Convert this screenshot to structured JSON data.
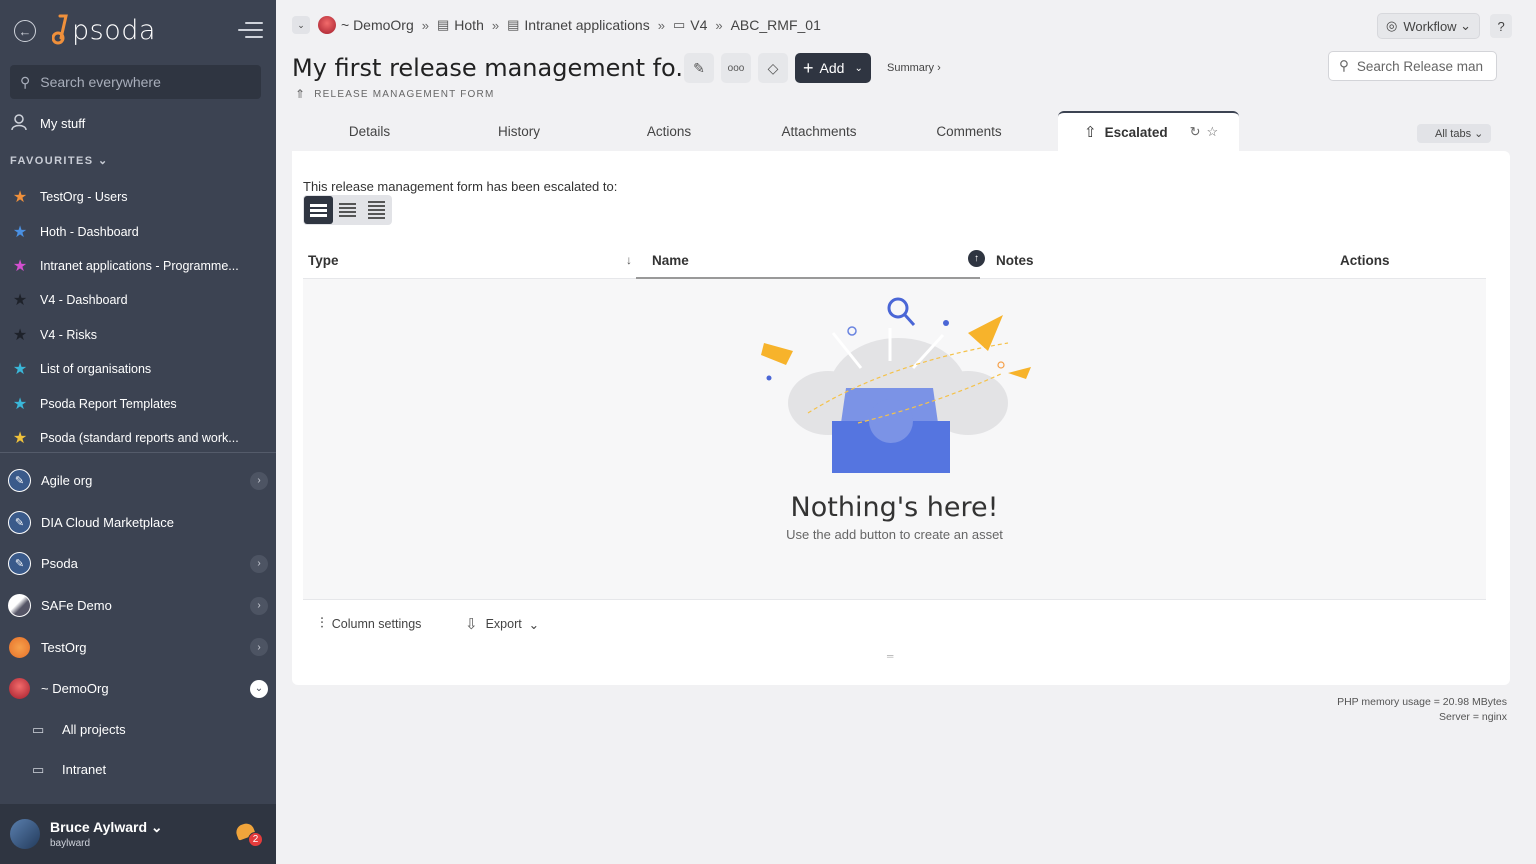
{
  "sidebar": {
    "logo_text": "psoda",
    "search_placeholder": "Search everywhere",
    "my_stuff": "My stuff",
    "favourites_header": "FAVOURITES",
    "favourites": [
      {
        "label": "TestOrg - Users",
        "color": "#f0903b"
      },
      {
        "label": "Hoth - Dashboard",
        "color": "#4a90e2"
      },
      {
        "label": "Intranet applications - Programme...",
        "color": "#d44fd0"
      },
      {
        "label": "V4 - Dashboard",
        "color": "#2a2f38"
      },
      {
        "label": "V4 - Risks",
        "color": "#2a2f38"
      },
      {
        "label": "List of organisations",
        "color": "#3ab7d9"
      },
      {
        "label": "Psoda Report Templates",
        "color": "#3ab7d9"
      },
      {
        "label": "Psoda (standard reports and work...",
        "color": "#f0c23b"
      }
    ],
    "orgs": [
      {
        "label": "Agile org",
        "has_chevron": true
      },
      {
        "label": "DIA Cloud Marketplace",
        "has_chevron": false
      },
      {
        "label": "Psoda",
        "has_chevron": true
      },
      {
        "label": "SAFe Demo",
        "has_chevron": true
      },
      {
        "label": "TestOrg",
        "has_chevron": true
      },
      {
        "label": "~ DemoOrg",
        "has_chevron": true,
        "expanded": true
      }
    ],
    "sub_items": [
      "All projects",
      "Intranet"
    ],
    "user": {
      "name": "Bruce Aylward",
      "username": "baylward",
      "notifications": "2"
    }
  },
  "breadcrumb": {
    "org": "~ DemoOrg",
    "items": [
      "Hoth",
      "Intranet applications",
      "V4",
      "ABC_RMF_01"
    ]
  },
  "header": {
    "workflow_label": "Workflow",
    "help_label": "?",
    "title": "My first release management fo...",
    "subtitle": "RELEASE MANAGEMENT FORM",
    "add_label": "Add",
    "summary_label": "Summary ›",
    "search_placeholder": "Search Release man"
  },
  "tabs": [
    "Details",
    "History",
    "Actions",
    "Attachments",
    "Comments"
  ],
  "active_tab": "Escalated",
  "all_tabs_label": "All tabs",
  "panel": {
    "intro": "This release management form has been escalated to:",
    "columns": [
      "Type",
      "Name",
      "Notes",
      "Actions"
    ],
    "empty_title": "Nothing's here!",
    "empty_sub": "Use the add button to create an asset",
    "column_settings": "Column settings",
    "export": "Export"
  },
  "footer": {
    "memory": "PHP memory usage = 20.98 MBytes",
    "server": "Server = nginx"
  }
}
